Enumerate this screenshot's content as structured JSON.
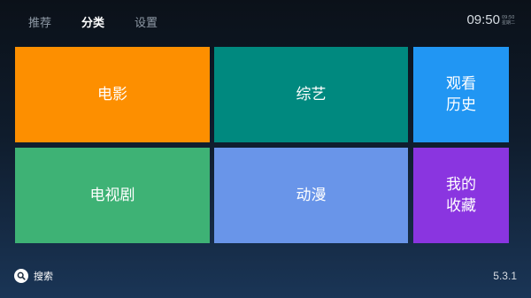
{
  "nav": {
    "tabs": [
      {
        "label": "推荐"
      },
      {
        "label": "分类"
      },
      {
        "label": "设置"
      }
    ],
    "active_index": 1
  },
  "clock": {
    "time": "09:50",
    "small_top": "09:50",
    "small_bottom": "星期二"
  },
  "tiles": {
    "movie": {
      "label": "电影",
      "color": "#fd8f00"
    },
    "variety": {
      "label": "综艺",
      "color": "#00897f"
    },
    "history": {
      "label": "观看\n历史",
      "color": "#2196f3"
    },
    "tv": {
      "label": "电视剧",
      "color": "#3eb275"
    },
    "anime": {
      "label": "动漫",
      "color": "#6995e9"
    },
    "favorites": {
      "label": "我的\n收藏",
      "color": "#8a35e0"
    }
  },
  "search": {
    "label": "搜索",
    "icon": "search-icon"
  },
  "version": "5.3.1"
}
